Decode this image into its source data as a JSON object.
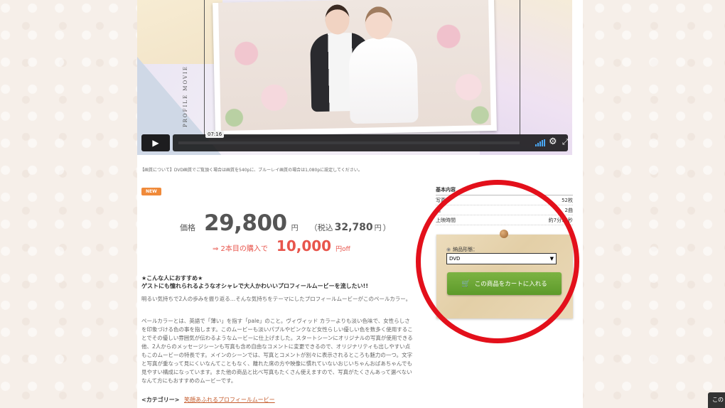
{
  "video": {
    "vertical_text": "PROFILE MOVIE",
    "time": "07:16"
  },
  "notice": "【画質について】DVD画質でご覧頂く場合は画質を540pに、ブルーレイ画質の場合は1,080pに設定してください。",
  "badge": "NEW",
  "price": {
    "label": "価格",
    "value": "29,800",
    "unit": "円",
    "tax_open": "（税込",
    "tax_value": "32,780",
    "tax_unit": "円",
    "tax_close": "）"
  },
  "discount": {
    "text": "⇒ 2本目の購入で",
    "value": "10,000",
    "unit": "円off"
  },
  "recommend": {
    "line1": "★こんな人におすすめ★",
    "line2": "ゲストにも憧れられるようなオシャレで大人かわいいプロフィールムービーを流したい!!"
  },
  "description": [
    "明るい気持ちで2人の歩みを振り返る…そんな気持ちをテーマにしたプロフィールムービーがこのペールカラー。",
    "ペールカラーとは、英語で「薄い」を指す「pale」のこと。ヴィヴィッド カラーよりも淡い色味で、女性らしさを印象づける色の事を指します。このムービーも淡いパプルやピンクなど女性らしい優しい色を数多く使用することでその優しい雰囲気が伝わるようなムービーに仕上げました。スタートシーンにオリジナルの写真が使用できる他、2人からのメッセージシーンも写真も含め自由なコメントに変更できるので、オリジナリティも出しやすい点もこのムービーの特長です。メインのシーンでは、写真とコメントが別々に表示されるところも魅力の一つ。文字と写真が重なって見にくいなんてこともなく、離れた席の方や映像に慣れていないおじいちゃんおばあちゃんでも見やすい構成になっています。また他の商品と比べ写真もたくさん使えますので、写真がたくさんあって選べないなんて方にもおすすめのムービーです。"
  ],
  "category": {
    "label": "<カテゴリー>",
    "link": "笑顔あふれるプロフィールムービー"
  },
  "spec": {
    "title": "基本内容",
    "rows": [
      {
        "label": "写真",
        "value": "52枚"
      },
      {
        "label": "曲",
        "value": "2曲"
      },
      {
        "label": "上映時間",
        "value": "約7分16秒"
      }
    ]
  },
  "cart": {
    "delivery_label": "納品形態：",
    "select_value": "DVD",
    "button": "この商品をカートに入れる"
  },
  "corner_button": "この"
}
